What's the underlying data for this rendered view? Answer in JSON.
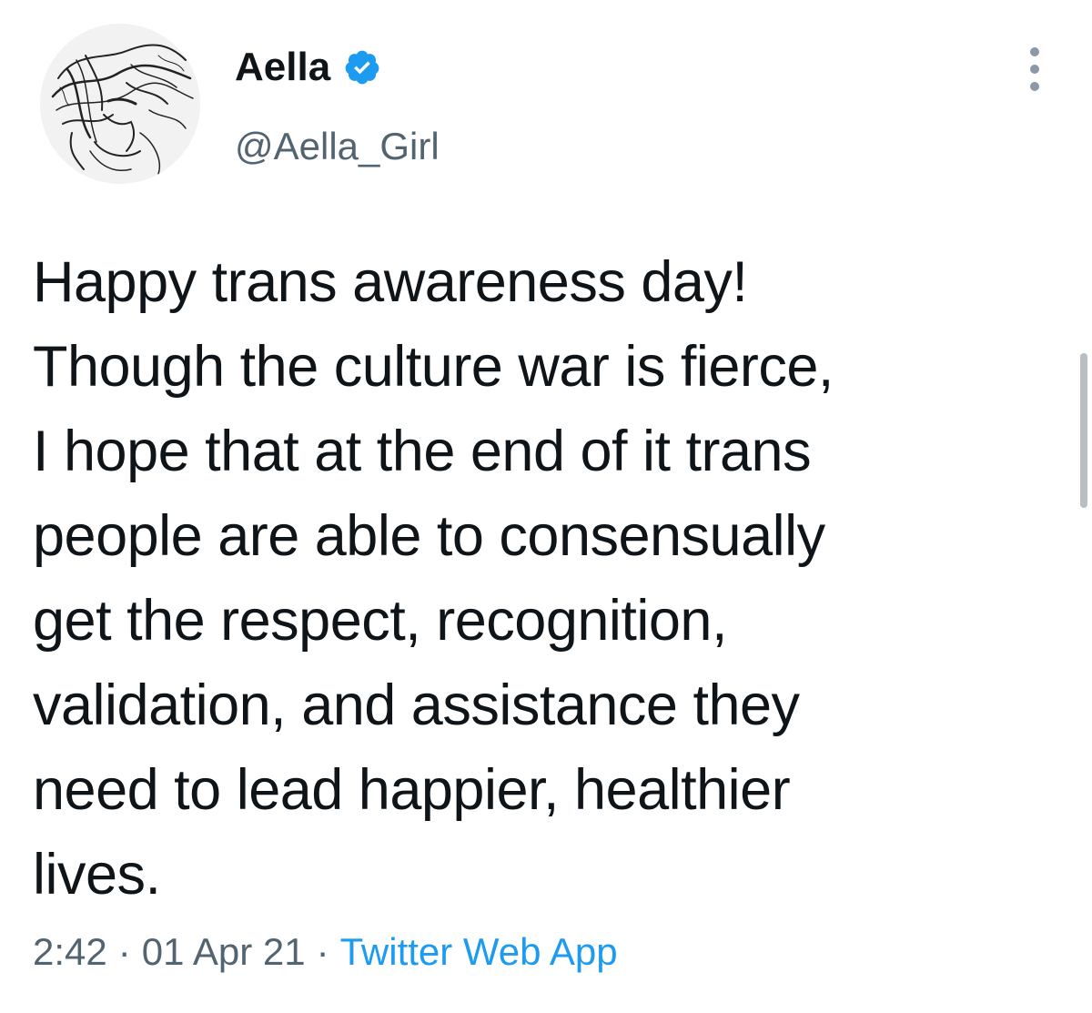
{
  "author": {
    "display_name": "Aella",
    "handle": "@Aella_Girl",
    "verified": true
  },
  "tweet": {
    "text_lines": [
      "Happy trans awareness day!",
      "Though the culture war is fierce,",
      "I hope that at the end of it trans",
      "people are able to consensually",
      "get the respect, recognition,",
      "validation, and assistance they",
      "need to lead happier, healthier",
      "lives."
    ],
    "time": "2:42",
    "date": "01 Apr 21",
    "separator": "·",
    "source": "Twitter Web App"
  },
  "icons": {
    "verified": "verified-badge-icon",
    "more": "more-vertical-icon"
  },
  "colors": {
    "accent": "#1d9bf0",
    "secondary_text": "#536471",
    "primary_text": "#0f1419"
  }
}
